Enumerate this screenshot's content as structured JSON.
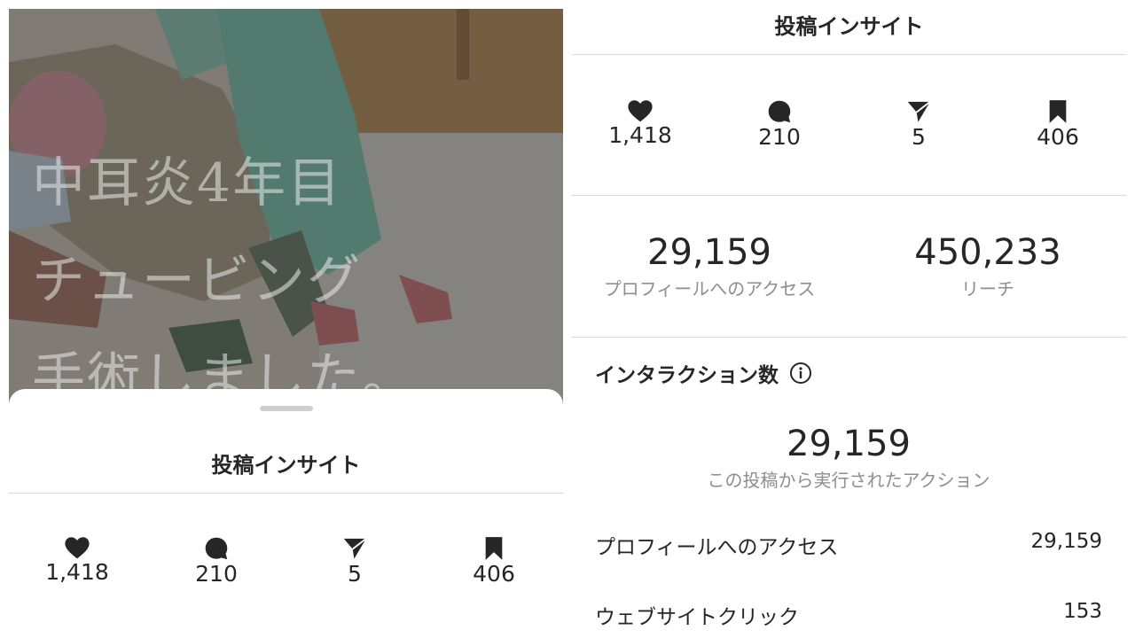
{
  "left": {
    "overlay_text": [
      "中耳炎4年目",
      "チュービング",
      "手術しました。"
    ],
    "sheet_title": "投稿インサイト",
    "stats": [
      {
        "icon": "heart-icon",
        "value": "1,418"
      },
      {
        "icon": "comment-icon",
        "value": "210"
      },
      {
        "icon": "send-icon",
        "value": "5"
      },
      {
        "icon": "bookmark-icon",
        "value": "406"
      }
    ]
  },
  "right": {
    "title": "投稿インサイト",
    "stats": [
      {
        "icon": "heart-icon",
        "value": "1,418"
      },
      {
        "icon": "comment-icon",
        "value": "210"
      },
      {
        "icon": "send-icon",
        "value": "5"
      },
      {
        "icon": "bookmark-icon",
        "value": "406"
      }
    ],
    "profile_access": {
      "value": "29,159",
      "label": "プロフィールへのアクセス"
    },
    "reach": {
      "value": "450,233",
      "label": "リーチ"
    },
    "interactions": {
      "heading": "インタラクション数",
      "total": "29,159",
      "total_label": "この投稿から実行されたアクション",
      "rows": [
        {
          "label": "プロフィールへのアクセス",
          "value": "29,159"
        },
        {
          "label": "ウェブサイトクリック",
          "value": "153"
        }
      ]
    }
  },
  "colors": {
    "text": "#262626",
    "secondary": "#8e8e8e",
    "divider": "#dbdbdb"
  }
}
